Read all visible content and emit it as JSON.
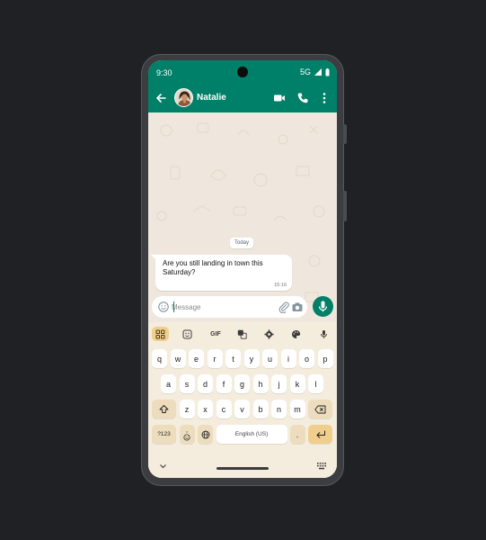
{
  "status_bar": {
    "time": "9:30",
    "network": "5G"
  },
  "chat_header": {
    "contact_name": "Natalie"
  },
  "conversation": {
    "date_divider": "Today",
    "messages": [
      {
        "text": "Are you still landing in town this Saturday?",
        "time": "15:16",
        "direction": "incoming"
      }
    ]
  },
  "composer": {
    "placeholder": "Message"
  },
  "keyboard": {
    "toolbar": {
      "gif_label": "GIF"
    },
    "row1": [
      "q",
      "w",
      "e",
      "r",
      "t",
      "y",
      "u",
      "i",
      "o",
      "p"
    ],
    "row2": [
      "a",
      "s",
      "d",
      "f",
      "g",
      "h",
      "j",
      "k",
      "l"
    ],
    "row3": [
      "z",
      "x",
      "c",
      "v",
      "b",
      "n",
      "m"
    ],
    "symbols_key": "?123",
    "emoji_key_top": ",",
    "space_label": "English (US)",
    "period_key": "."
  },
  "colors": {
    "accent": "#008069",
    "chat_background": "#efe7dd",
    "keyboard_background": "#f4ecdd",
    "key_highlight": "#f0cf8c"
  }
}
